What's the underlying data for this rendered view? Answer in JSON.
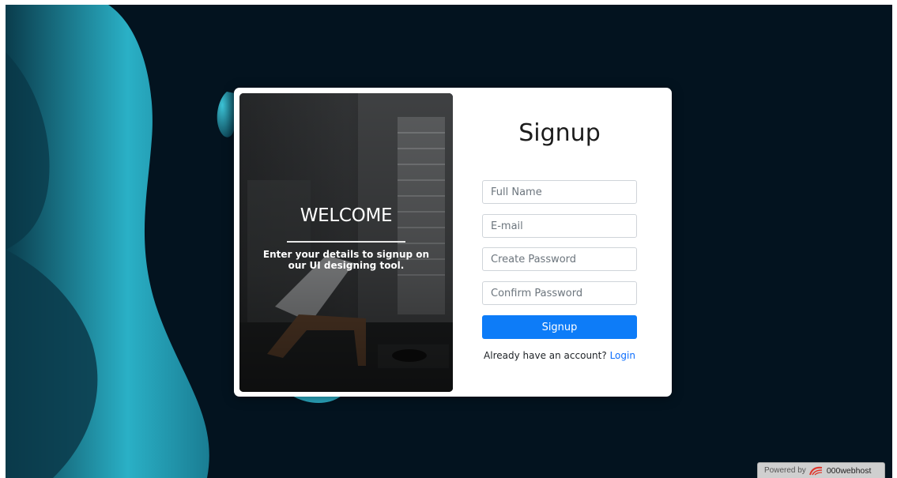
{
  "welcome": {
    "title": "WELCOME",
    "text": "Enter your details to signup on our UI designing tool."
  },
  "form": {
    "title": "Signup",
    "fields": [
      {
        "placeholder": "Full Name",
        "value": ""
      },
      {
        "placeholder": "E-mail",
        "value": ""
      },
      {
        "placeholder": "Create Password",
        "value": ""
      },
      {
        "placeholder": "Confirm Password",
        "value": ""
      }
    ],
    "submit_label": "Signup",
    "login_prompt": "Already have an account?",
    "login_link": "Login"
  },
  "badge": {
    "prefix": "Powered by",
    "brand": "000webhost"
  },
  "colors": {
    "background": "#03131f",
    "accent": "#0d7cf8",
    "link": "#0d6efd",
    "blob": "#2fb3c8"
  }
}
